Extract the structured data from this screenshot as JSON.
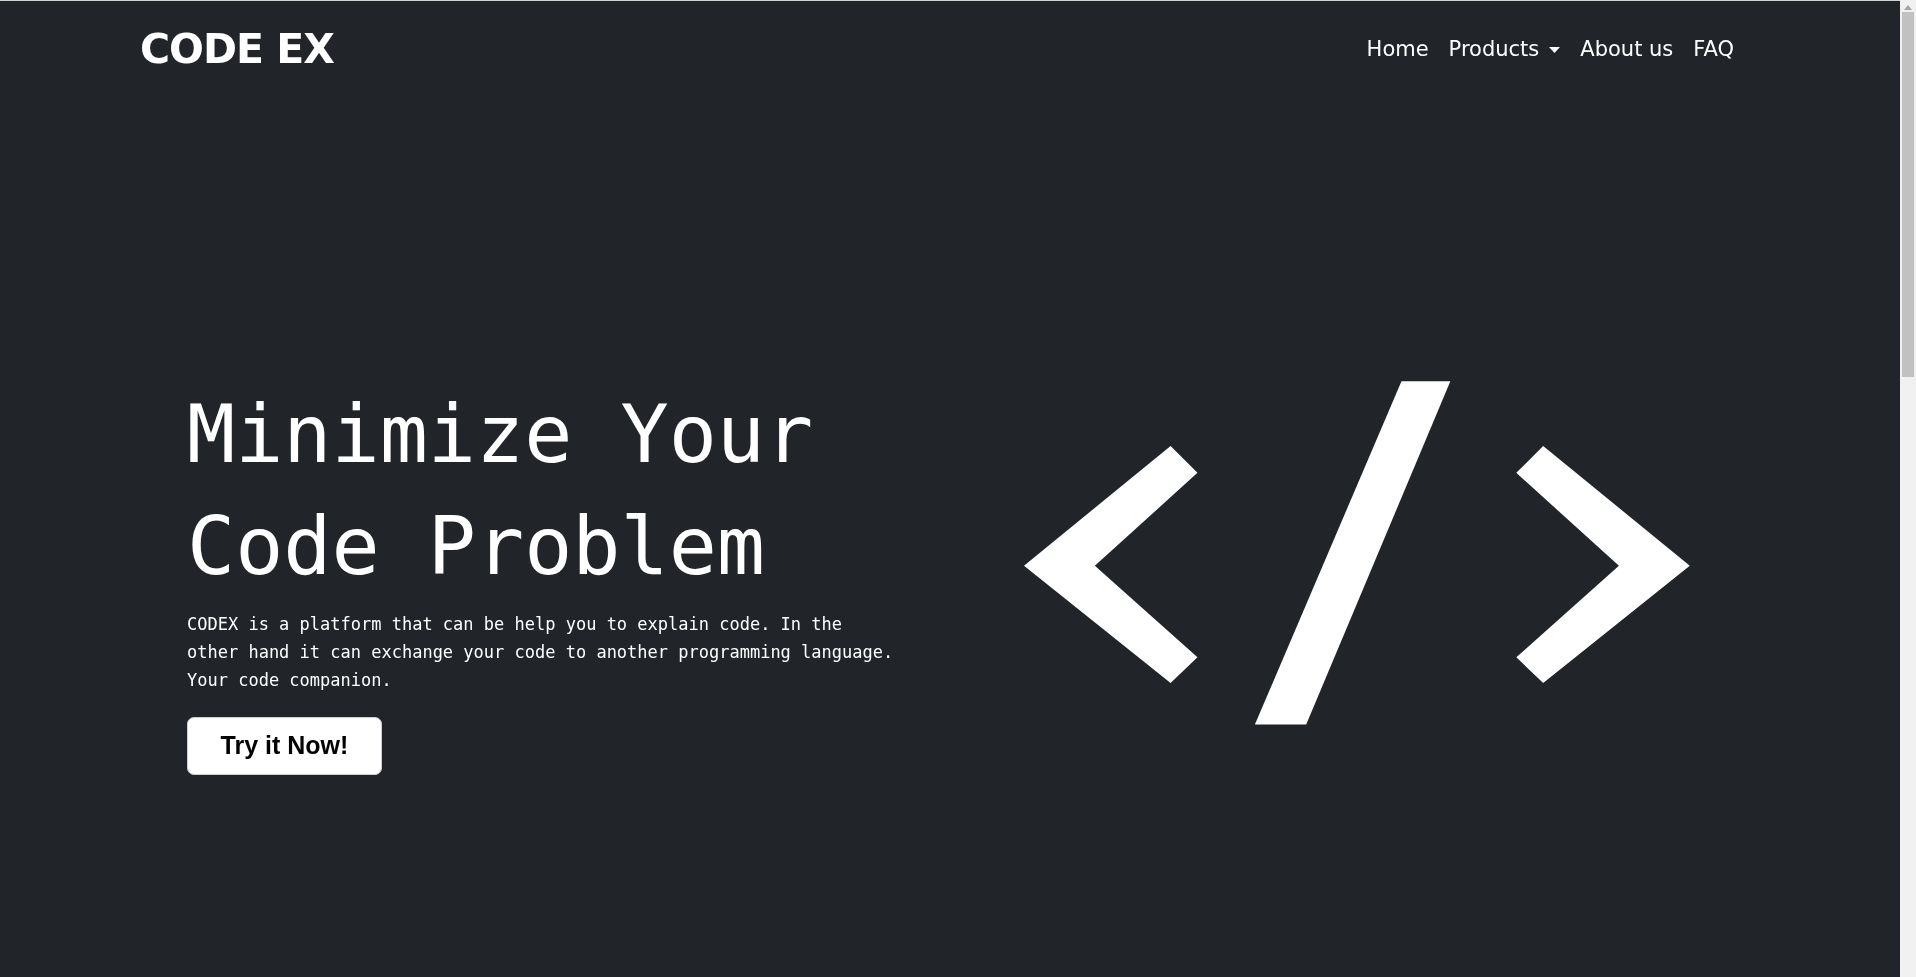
{
  "navbar": {
    "brand": "CODE EX",
    "items": [
      {
        "label": "Home",
        "kind": "link"
      },
      {
        "label": "Products",
        "kind": "dropdown"
      },
      {
        "label": "About us",
        "kind": "link"
      },
      {
        "label": "FAQ",
        "kind": "link"
      }
    ]
  },
  "hero": {
    "title": "Minimize Your Code Problem",
    "description": "CODEX is a platform that can be help you to explain code. In the other hand it can exchange your code to another programming language. Your code companion.",
    "button": "Try it Now!"
  }
}
